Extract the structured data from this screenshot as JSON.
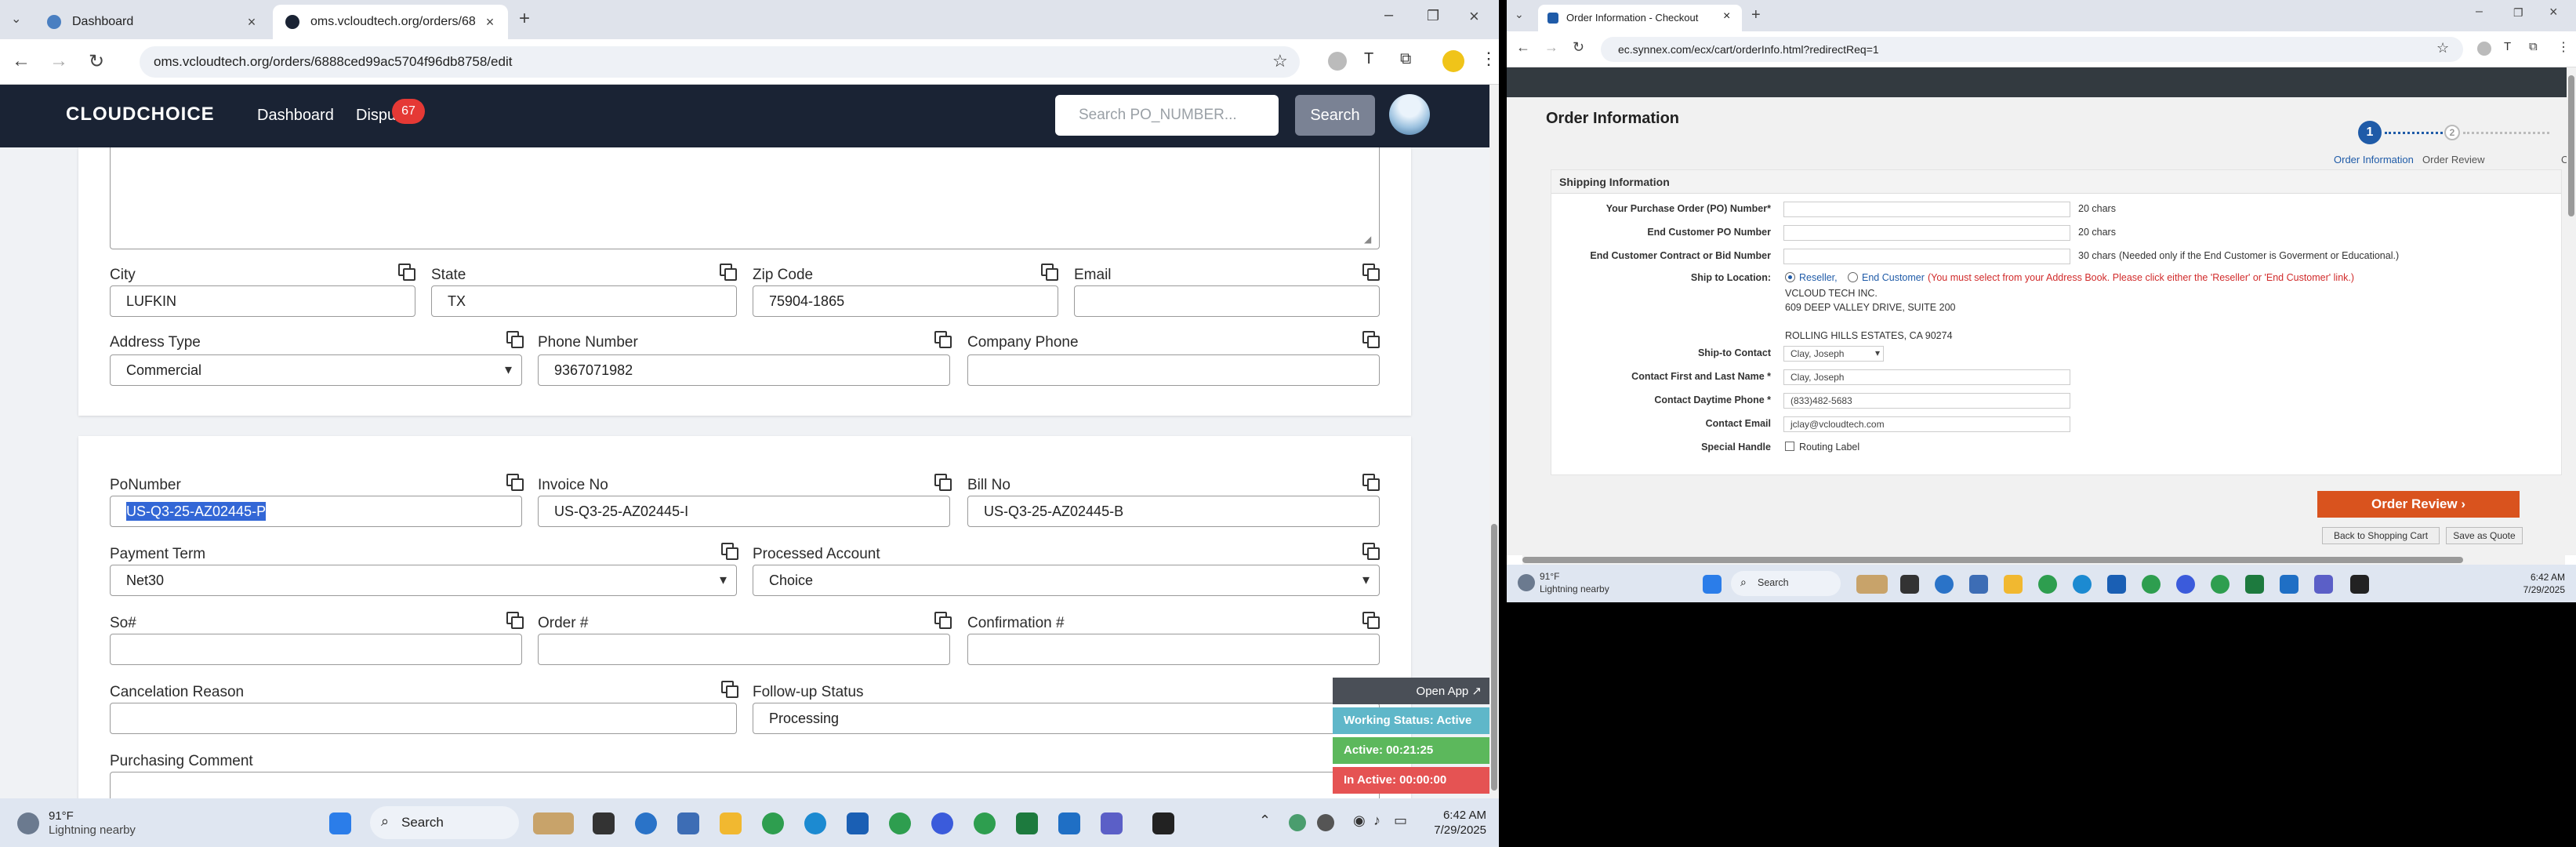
{
  "left_browser": {
    "tabs": [
      {
        "title": "Dashboard",
        "icon": "globe-icon",
        "color": "#4a7fc1"
      },
      {
        "title": "oms.vcloudtech.org/orders/68",
        "icon": "site-icon",
        "color": "#1a2334"
      }
    ],
    "url": "oms.vcloudtech.org/orders/6888ced99ac5704f96db8758/edit"
  },
  "app": {
    "logo": "CLOUDCHOICE",
    "nav": {
      "dashboard": "Dashboard",
      "disputes": "Dispu",
      "disputes_badge": "67"
    },
    "search_placeholder": "Search PO_NUMBER...",
    "search_button": "Search"
  },
  "address_card": {
    "city_label": "City",
    "city_value": "LUFKIN",
    "state_label": "State",
    "state_value": "TX",
    "zip_label": "Zip Code",
    "zip_value": "75904-1865",
    "email_label": "Email",
    "email_value": "",
    "address_type_label": "Address Type",
    "address_type_value": "Commercial",
    "phone_label": "Phone Number",
    "phone_value": "9367071982",
    "company_phone_label": "Company Phone",
    "company_phone_value": ""
  },
  "order_card": {
    "po_label": "PoNumber",
    "po_value": "US-Q3-25-AZ02445-P",
    "invoice_label": "Invoice No",
    "invoice_value": "US-Q3-25-AZ02445-I",
    "bill_label": "Bill No",
    "bill_value": "US-Q3-25-AZ02445-B",
    "payment_label": "Payment Term",
    "payment_value": "Net30",
    "processed_label": "Processed Account",
    "processed_value": "Choice",
    "so_label": "So#",
    "so_value": "",
    "order_label": "Order #",
    "order_value": "",
    "confirmation_label": "Confirmation #",
    "confirmation_value": "",
    "cancel_label": "Cancelation Reason",
    "cancel_value": "",
    "followup_label": "Follow-up Status",
    "followup_value": "Processing",
    "purchasing_label": "Purchasing Comment"
  },
  "widget": {
    "open_app": "Open App ↗",
    "working": "Working Status: Active",
    "active": "Active: 00:21:25",
    "inactive": "In Active: 00:00:00"
  },
  "taskbar_left": {
    "temp": "91°F",
    "weather": "Lightning nearby",
    "search": "Search",
    "time": "6:42 AM",
    "date": "7/29/2025"
  },
  "right_browser": {
    "tab_title": "Order Information - Checkout",
    "url": "ec.synnex.com/ecx/cart/orderInfo.html?redirectReq=1",
    "page_title": "Order Information",
    "steps": [
      {
        "num": "1",
        "label": "Order Information"
      },
      {
        "num": "2",
        "label": "Order Review"
      },
      {
        "num": "",
        "label": "O"
      }
    ],
    "section_title": "Shipping Information",
    "po_label": "Your Purchase Order (PO) Number*",
    "po_chars": "20 chars",
    "end_po_label": "End Customer PO Number",
    "end_po_chars": "20 chars",
    "contract_label": "End Customer Contract or Bid Number",
    "contract_chars": "30 chars",
    "contract_note": "(Needed only if the End Customer is Goverment or Educational.)",
    "ship_to_label": "Ship to Location:",
    "reseller": "Reseller,",
    "end_customer": "End Customer",
    "ship_note": "(You must select from your Address Book. Please click either the 'Reseller' or 'End Customer' link.)",
    "address_lines": [
      "VCLOUD TECH INC.",
      "609 DEEP VALLEY DRIVE, SUITE 200",
      "",
      "ROLLING HILLS ESTATES, CA 90274"
    ],
    "ship_contact_label": "Ship-to Contact",
    "ship_contact_value": "Clay, Joseph",
    "contact_name_label": "Contact First and Last Name *",
    "contact_name_value": "Clay, Joseph",
    "contact_phone_label": "Contact Daytime Phone *",
    "contact_phone_value": "(833)482-5683",
    "contact_email_label": "Contact Email",
    "contact_email_value": "jclay@vcloudtech.com",
    "special_label": "Special Handle",
    "routing_label": "Routing Label",
    "order_review_btn": "Order Review ›",
    "back_btn": "Back to Shopping Cart",
    "save_quote_btn": "Save as Quote"
  },
  "taskbar_right": {
    "temp": "91°F",
    "weather": "Lightning nearby",
    "search": "Search",
    "time": "6:42 AM",
    "date": "7/29/2025"
  }
}
